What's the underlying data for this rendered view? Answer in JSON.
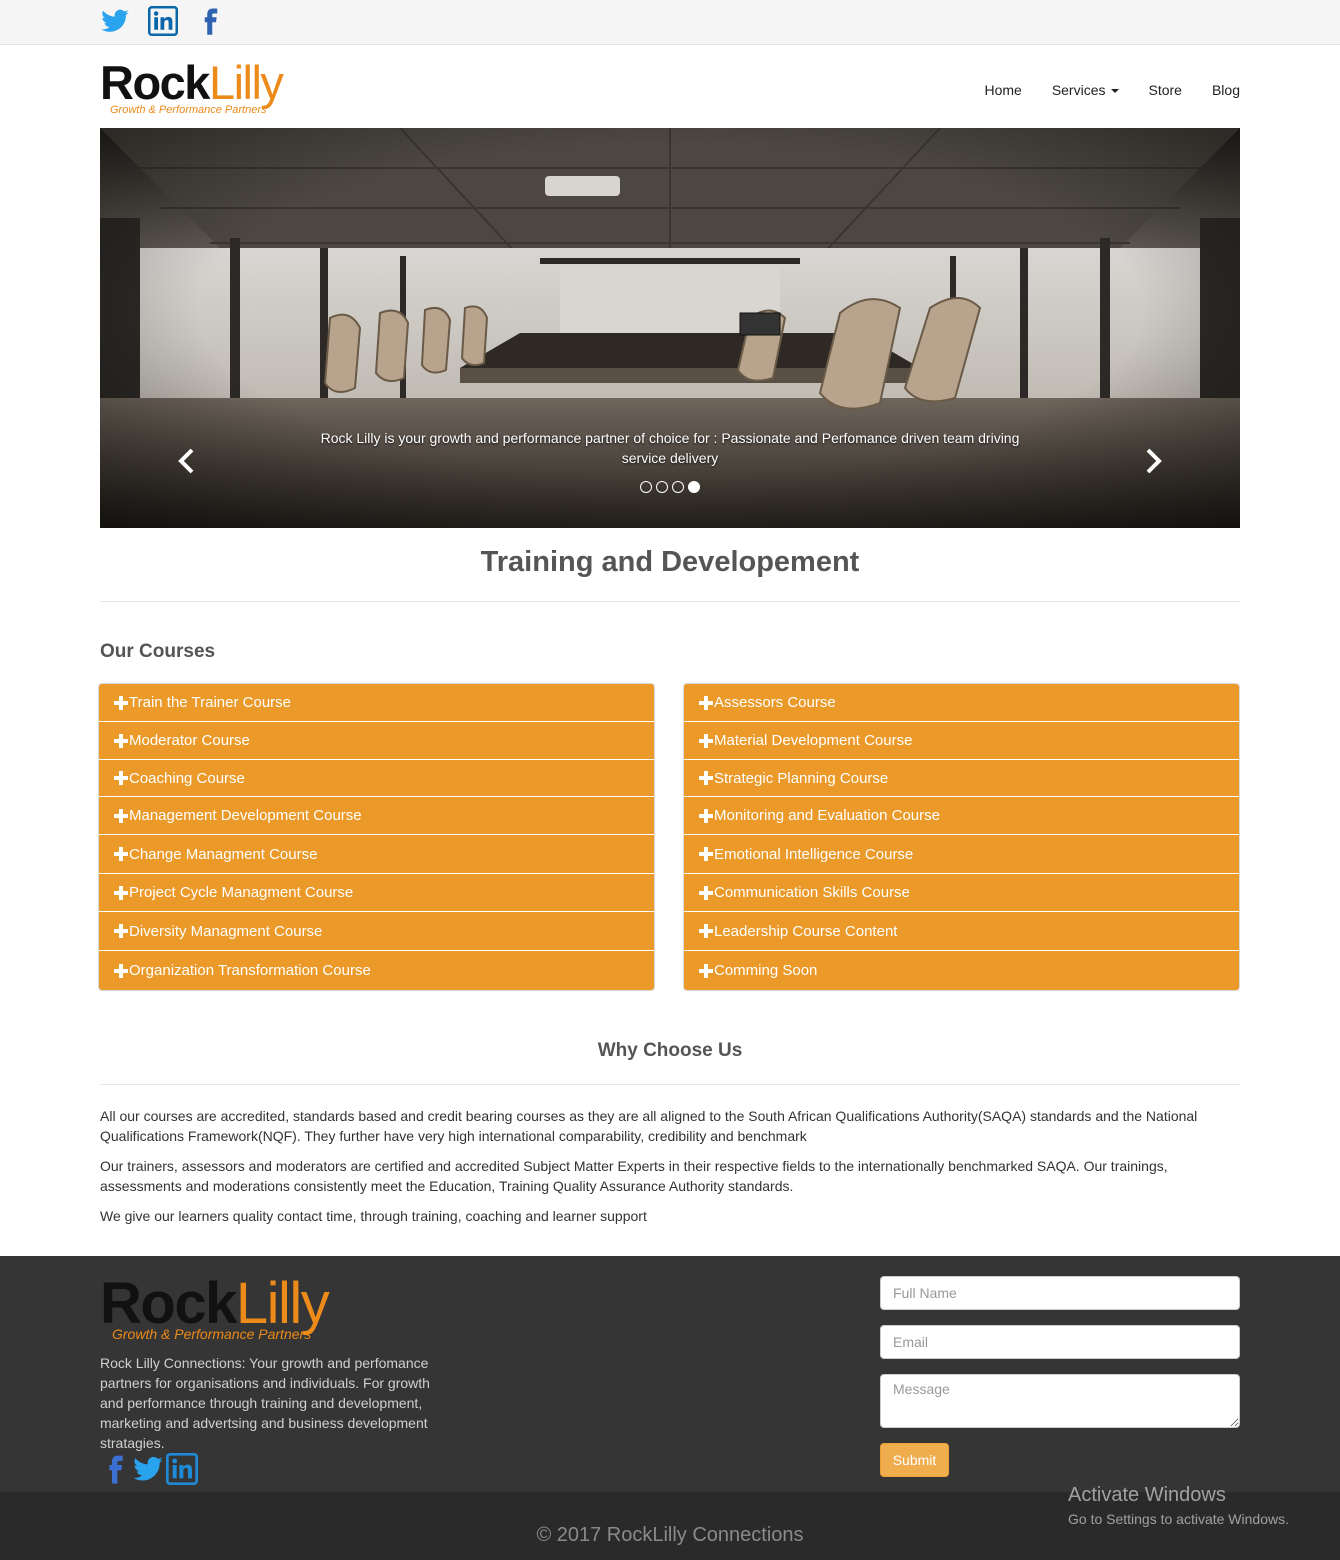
{
  "social_top": {
    "twitter": "twitter-icon",
    "linkedin": "linkedin-icon",
    "facebook": "facebook-icon"
  },
  "logo": {
    "part1": "Rock",
    "part2": "Lilly",
    "tagline": "Growth & Performance Partners"
  },
  "nav": {
    "home": "Home",
    "services": "Services",
    "store": "Store",
    "blog": "Blog"
  },
  "carousel": {
    "caption": "Rock Lilly is your growth and performance partner of choice for : Passionate and Perfomance driven team driving service delivery",
    "slide_count": 4,
    "active_slide": 4
  },
  "main": {
    "title": "Training and Developement",
    "courses_heading": "Our Courses",
    "courses_left": [
      "Train the Trainer Course",
      "Moderator Course",
      "Coaching Course",
      "Management Development Course",
      "Change Managment Course",
      "Project Cycle Managment Course",
      "Diversity Managment Course",
      "Organization Transformation Course"
    ],
    "courses_right": [
      "Assessors Course",
      "Material Development Course",
      "Strategic Planning Course",
      "Monitoring and Evaluation Course",
      "Emotional Intelligence Course",
      "Communication Skills Course",
      "Leadership Course Content",
      "Comming Soon"
    ],
    "why_heading": "Why Choose Us",
    "why_paragraphs": [
      "All our courses are accredited, standards based and credit bearing courses as they are all aligned to the South African Qualifications Authority(SAQA) standards and the National Qualifications Framework(NQF). They further have very high international comparability, credibility and benchmark",
      "Our trainers, assessors and moderators are certified and accredited Subject Matter Experts in their respective fields to the internationally benchmarked SAQA. Our trainings, assessments and moderations consistently meet the Education, Training Quality Assurance Authority standards.",
      "We give our learners quality contact time, through training, coaching and learner support"
    ]
  },
  "footer": {
    "about": "Rock Lilly Connections: Your growth and perfomance partners for organisations and individuals. For growth and performance through training and development, marketing and advertsing and business development stratagies.",
    "form": {
      "name_placeholder": "Full Name",
      "email_placeholder": "Email",
      "message_placeholder": "Message",
      "submit_label": "Submit"
    },
    "copyright": "© 2017 RockLilly Connections"
  },
  "os_watermark": {
    "title": "Activate Windows",
    "subtitle": "Go to Settings to activate Windows."
  },
  "colors": {
    "accent": "#eb9a2a",
    "footer_bg": "#353535",
    "twitter": "#2aa3ef",
    "linkedin": "#0a66a8",
    "facebook": "#3b5998"
  }
}
